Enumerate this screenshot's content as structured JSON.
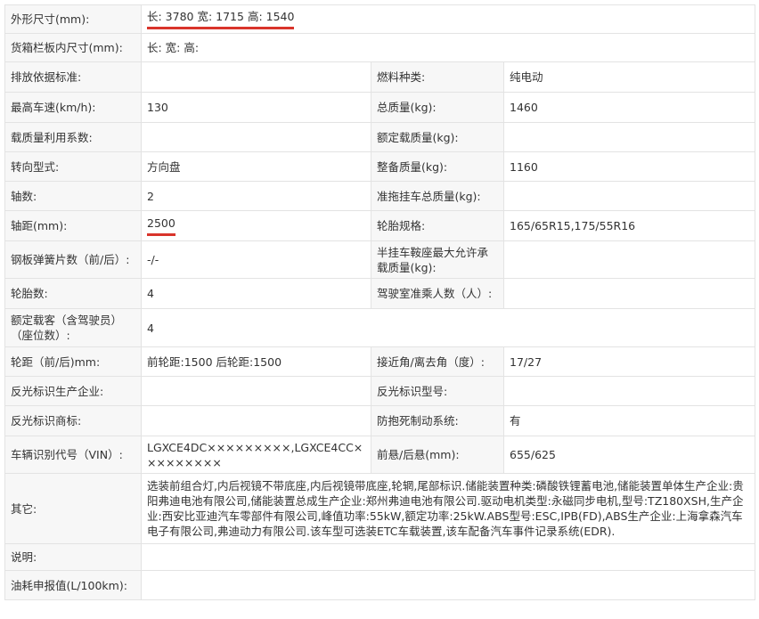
{
  "highlight_color": "#d9342b",
  "rows": [
    {
      "label": "外形尺寸(mm):",
      "value": "长: 3780 宽: 1715 高: 1540"
    },
    {
      "label": "货箱栏板内尺寸(mm):",
      "value": "长:  宽:  高:"
    },
    {
      "label": "排放依据标准:",
      "value": "",
      "label2": "燃料种类:",
      "value2": "纯电动"
    },
    {
      "label": "最高车速(km/h):",
      "value": "130",
      "label2": "总质量(kg):",
      "value2": "1460"
    },
    {
      "label": "载质量利用系数:",
      "value": "",
      "label2": "额定载质量(kg):",
      "value2": ""
    },
    {
      "label": "转向型式:",
      "value": "方向盘",
      "label2": "整备质量(kg):",
      "value2": "1160"
    },
    {
      "label": "轴数:",
      "value": "2",
      "label2": "准拖挂车总质量(kg):",
      "value2": ""
    },
    {
      "label": "轴距(mm):",
      "value": "2500",
      "label2": "轮胎规格:",
      "value2": "165/65R15,175/55R16"
    },
    {
      "label": "钢板弹簧片数（前/后）:",
      "value": "-/-",
      "label2": "半挂车鞍座最大允许承载质量(kg):",
      "value2": ""
    },
    {
      "label": "轮胎数:",
      "value": "4",
      "label2": "驾驶室准乘人数（人）:",
      "value2": ""
    },
    {
      "label": "额定载客（含驾驶员）（座位数）:",
      "value": "4"
    },
    {
      "label": "轮距（前/后)mm:",
      "value": "前轮距:1500 后轮距:1500",
      "label2": "接近角/离去角（度）:",
      "value2": "17/27"
    },
    {
      "label": "反光标识生产企业:",
      "value": "",
      "label2": "反光标识型号:",
      "value2": ""
    },
    {
      "label": "反光标识商标:",
      "value": "",
      "label2": "防抱死制动系统:",
      "value2": "有"
    },
    {
      "label": "车辆识别代号（VIN）:",
      "value": "LGXCE4DC×××××××××,LGXCE4CC×××××××××",
      "label2": "前悬/后悬(mm):",
      "value2": "655/625"
    },
    {
      "label": "其它:",
      "value": "选装前组合灯,内后视镜不带底座,内后视镜带底座,轮辋,尾部标识.储能装置种类:磷酸铁锂蓄电池,储能装置单体生产企业:贵阳弗迪电池有限公司,储能装置总成生产企业:郑州弗迪电池有限公司.驱动电机类型:永磁同步电机,型号:TZ180XSH,生产企业:西安比亚迪汽车零部件有限公司,峰值功率:55kW,额定功率:25kW.ABS型号:ESC,IPB(FD),ABS生产企业:上海拿森汽车电子有限公司,弗迪动力有限公司.该车型可选装ETC车载装置,该车配备汽车事件记录系统(EDR)."
    },
    {
      "label": "说明:",
      "value": ""
    },
    {
      "label": "油耗申报值(L/100km):",
      "value": ""
    }
  ]
}
